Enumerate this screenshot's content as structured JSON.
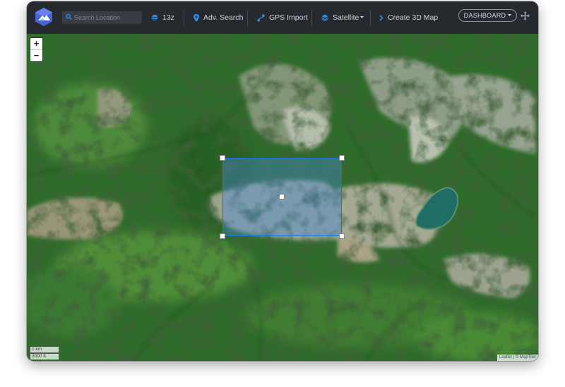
{
  "toolbar": {
    "search_placeholder": "Search Location",
    "zoom_level": "13z",
    "adv_search": "Adv. Search",
    "gps_import": "GPS Import",
    "layer": "Satellite",
    "create_3d": "Create 3D Map",
    "dashboard": "DASHBOARD"
  },
  "map": {
    "zoom_in": "+",
    "zoom_out": "−",
    "scale_km": "1 km",
    "scale_ft": "3000 ft",
    "attribution": "Leaflet | © MapTiler"
  },
  "colors": {
    "toolbar_bg": "#26292e",
    "accent_blue": "#2f8fe8",
    "selection_blue": "#1e74d6",
    "lake": "#1f6e66",
    "forest": "#2f6b2a"
  },
  "icons": [
    "logo-icon",
    "search-icon",
    "globe-icon",
    "pin-icon",
    "route-icon",
    "layers-icon",
    "chevron-right-icon",
    "caret-down-icon",
    "move-icon"
  ]
}
